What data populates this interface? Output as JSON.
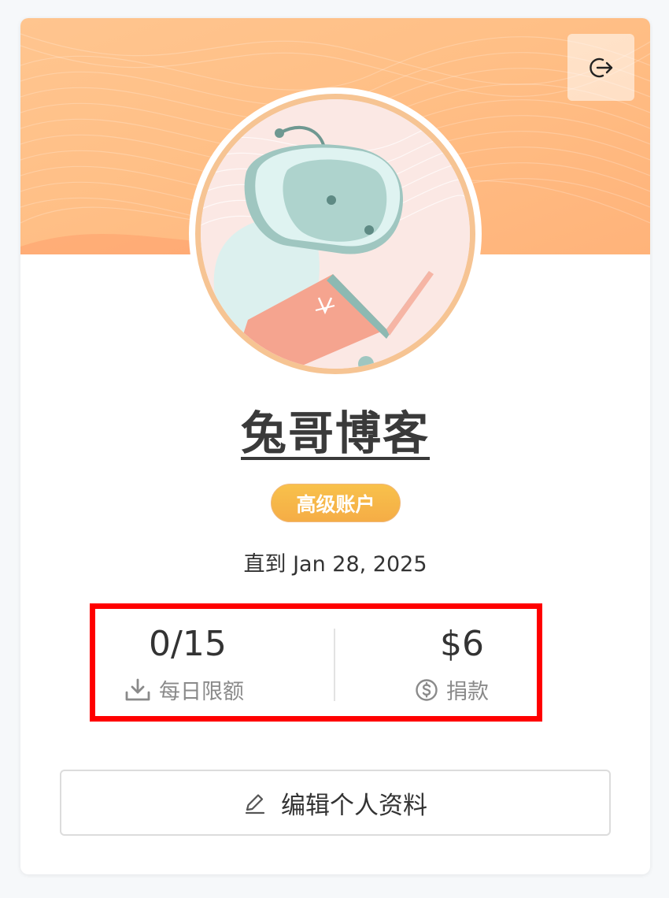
{
  "profile": {
    "name": "兔哥博客",
    "badge": "高级账户",
    "expiry": "直到 Jan 28, 2025"
  },
  "stats": {
    "quota_value": "0/15",
    "quota_label": "每日限额",
    "donation_value": "$6",
    "donation_label": "捐款"
  },
  "actions": {
    "edit_label": "编辑个人资料"
  },
  "icons": {
    "logout": "logout-icon",
    "download": "download-icon",
    "dollar": "dollar-circle-icon",
    "edit": "pencil-icon"
  },
  "colors": {
    "banner_start": "#ffb77a",
    "banner_end": "#ffcf8e",
    "badge": "#f7b84a",
    "highlight": "#ff0000"
  }
}
